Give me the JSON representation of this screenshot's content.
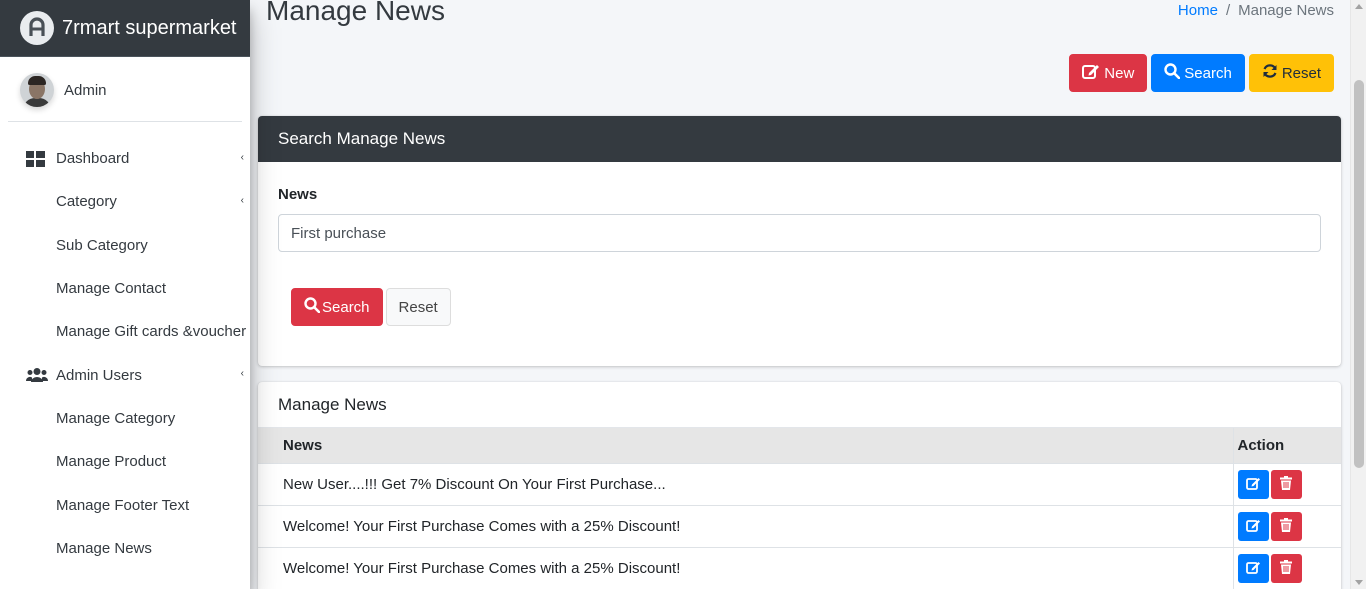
{
  "brand": {
    "name": "7rmart supermarket"
  },
  "user": {
    "name": "Admin"
  },
  "sidebar": {
    "items": [
      {
        "label": "Dashboard",
        "icon": "dashboard-grid-icon",
        "caret": "‹"
      },
      {
        "label": "Category",
        "caret": "‹"
      },
      {
        "label": "Sub Category"
      },
      {
        "label": "Manage Contact"
      },
      {
        "label": "Manage Gift cards &voucher"
      },
      {
        "label": "Admin Users",
        "icon": "users-icon",
        "caret": "‹"
      },
      {
        "label": "Manage Category"
      },
      {
        "label": "Manage Product"
      },
      {
        "label": "Manage Footer Text"
      },
      {
        "label": "Manage News"
      }
    ]
  },
  "header": {
    "title": "Manage News",
    "breadcrumb": {
      "home": "Home",
      "separator": "/",
      "current": "Manage News"
    }
  },
  "actions": {
    "new_label": "New",
    "search_label": "Search",
    "reset_label": "Reset"
  },
  "search_card": {
    "title": "Search Manage News",
    "field_label": "News",
    "field_value": "First purchase",
    "search_label": "Search",
    "reset_label": "Reset"
  },
  "list_card": {
    "title": "Manage News",
    "columns": [
      "News",
      "Action"
    ],
    "rows": [
      "New User....!!! Get 7% Discount On Your First Purchase...",
      "Welcome! Your First Purchase Comes with a 25% Discount!",
      "Welcome! Your First Purchase Comes with a 25% Discount!"
    ]
  },
  "colors": {
    "sidebar_header": "#343a40",
    "danger": "#dc3545",
    "primary": "#007bff",
    "warning": "#ffc107",
    "link": "#007bff"
  }
}
